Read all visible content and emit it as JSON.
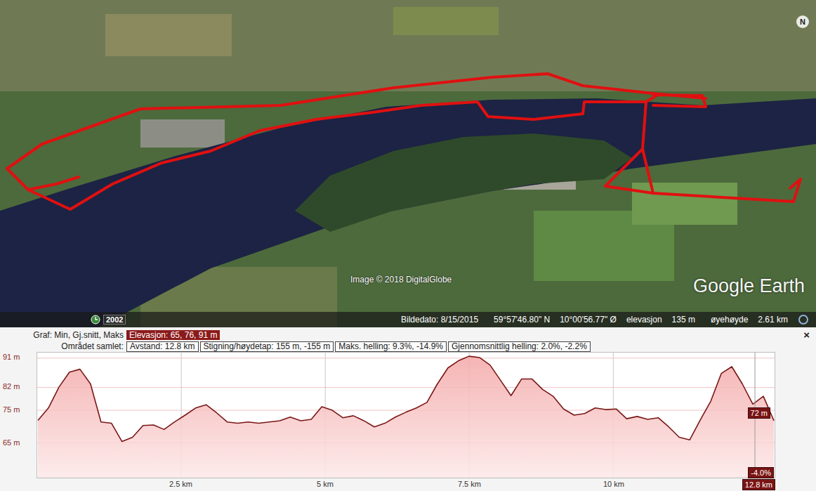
{
  "map": {
    "attribution": "Image © 2018 DigitalGlobe",
    "logo": "Google Earth",
    "compass": "N"
  },
  "status_bar": {
    "history_year": "2002",
    "image_date": "Bildedato: 8/15/2015",
    "latitude": "59°57'46.80\" N",
    "longitude": "10°00'56.77\" Ø",
    "elevation_label": "elevasjon",
    "elevation": "135 m",
    "eye_alt_label": "øyehøyde",
    "eye_alt": "2.61 km"
  },
  "profile": {
    "graph_label": "Graf: Min, Gj.snitt, Maks",
    "elevation_summary": "Elevasjon: 65, 76, 91 m",
    "area_label": "Området samlet:",
    "stats": [
      "Avstand: 12.8 km",
      "Stigning/høydetap: 155 m, -155 m",
      "Maks. helling: 9.3%, -14.9%",
      "Gjennomsnittlig helling: 2.0%, -2.2%"
    ],
    "close": "×"
  },
  "chart": {
    "y_ticks": [
      {
        "label": "91 m",
        "value": 91
      },
      {
        "label": "82 m",
        "value": 82
      },
      {
        "label": "75 m",
        "value": 75
      },
      {
        "label": "65 m",
        "value": 65
      }
    ],
    "x_ticks": [
      {
        "label": "2.5 km",
        "value": 2.5
      },
      {
        "label": "5 km",
        "value": 5
      },
      {
        "label": "7.5 km",
        "value": 7.5
      },
      {
        "label": "10 km",
        "value": 10
      }
    ],
    "x_max": 12.8,
    "series": [
      {
        "values": [
          71.9,
          75.7,
          82.1,
          86.7,
          87.6,
          83.1,
          71.4,
          71.0,
          65.4,
          66.7,
          70.3,
          70.5,
          69.1,
          71.4,
          73.5,
          75.7,
          76.7,
          74.2,
          71.4,
          71.0,
          71.4,
          71.0,
          71.4,
          71.8,
          72.9,
          71.8,
          72.2,
          76.1,
          75.0,
          72.7,
          73.3,
          71.8,
          69.9,
          71.0,
          72.9,
          74.4,
          75.7,
          77.4,
          83.1,
          88.0,
          90.2,
          91.6,
          91.2,
          88.9,
          84.2,
          79.5,
          84.6,
          84.6,
          81.4,
          79.3,
          75.4,
          73.5,
          74.0,
          75.7,
          75.2,
          75.4,
          72.4,
          73.1,
          72.2,
          72.7,
          69.9,
          66.7,
          65.9,
          72.0,
          77.8,
          86.3,
          88.4,
          83.1,
          76.9,
          79.3,
          71.8
        ]
      }
    ],
    "cursor": {
      "elevation": "72 m",
      "grade": "-4.0%",
      "distance": "12.8 km"
    }
  }
}
